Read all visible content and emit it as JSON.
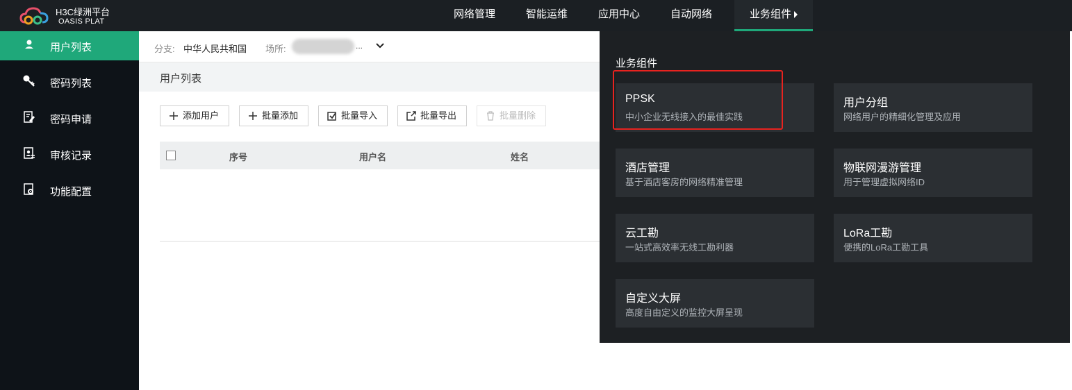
{
  "brand": {
    "name": "H3C绿洲平台",
    "sub": "OASIS PLAT"
  },
  "topnav": [
    {
      "label": "网络管理"
    },
    {
      "label": "智能运维"
    },
    {
      "label": "应用中心"
    },
    {
      "label": "自动网络"
    },
    {
      "label": "业务组件"
    }
  ],
  "sidebar": [
    {
      "label": "用户列表",
      "icon": "user-icon"
    },
    {
      "label": "密码列表",
      "icon": "key-icon"
    },
    {
      "label": "密码申请",
      "icon": "edit-document-icon"
    },
    {
      "label": "审核记录",
      "icon": "audit-record-icon"
    },
    {
      "label": "功能配置",
      "icon": "settings-document-icon"
    }
  ],
  "filter": {
    "branch_label": "分支:",
    "branch_value": "中华人民共和国",
    "site_label": "场所:",
    "site_ellipsis": "..."
  },
  "section_title": "用户列表",
  "toolbar": [
    {
      "label": "添加用户",
      "icon": "plus-icon"
    },
    {
      "label": "批量添加",
      "icon": "plus-icon"
    },
    {
      "label": "批量导入",
      "icon": "import-icon"
    },
    {
      "label": "批量导出",
      "icon": "export-icon"
    },
    {
      "label": "批量删除",
      "icon": "trash-icon",
      "disabled": true
    }
  ],
  "table": {
    "headers": [
      "序号",
      "用户名",
      "姓名"
    ]
  },
  "panel": {
    "title": "业务组件",
    "cards": [
      {
        "title": "PPSK",
        "desc": "中小企业无线接入的最佳实践"
      },
      {
        "title": "用户分组",
        "desc": "网络用户的精细化管理及应用"
      },
      {
        "title": "酒店管理",
        "desc": "基于酒店客房的网络精准管理"
      },
      {
        "title": "物联网漫游管理",
        "desc": "用于管理虚拟网络ID"
      },
      {
        "title": "云工勘",
        "desc": "一站式高效率无线工勘利器"
      },
      {
        "title": "LoRa工勘",
        "desc": "便携的LoRa工勘工具"
      },
      {
        "title": "自定义大屏",
        "desc": "高度自由定义的监控大屏呈现"
      }
    ]
  },
  "colors": {
    "accent": "#1fa87a",
    "highlight": "#e8231f",
    "sidebar_bg": "#0e1318",
    "panel_bg": "#1d2023"
  }
}
